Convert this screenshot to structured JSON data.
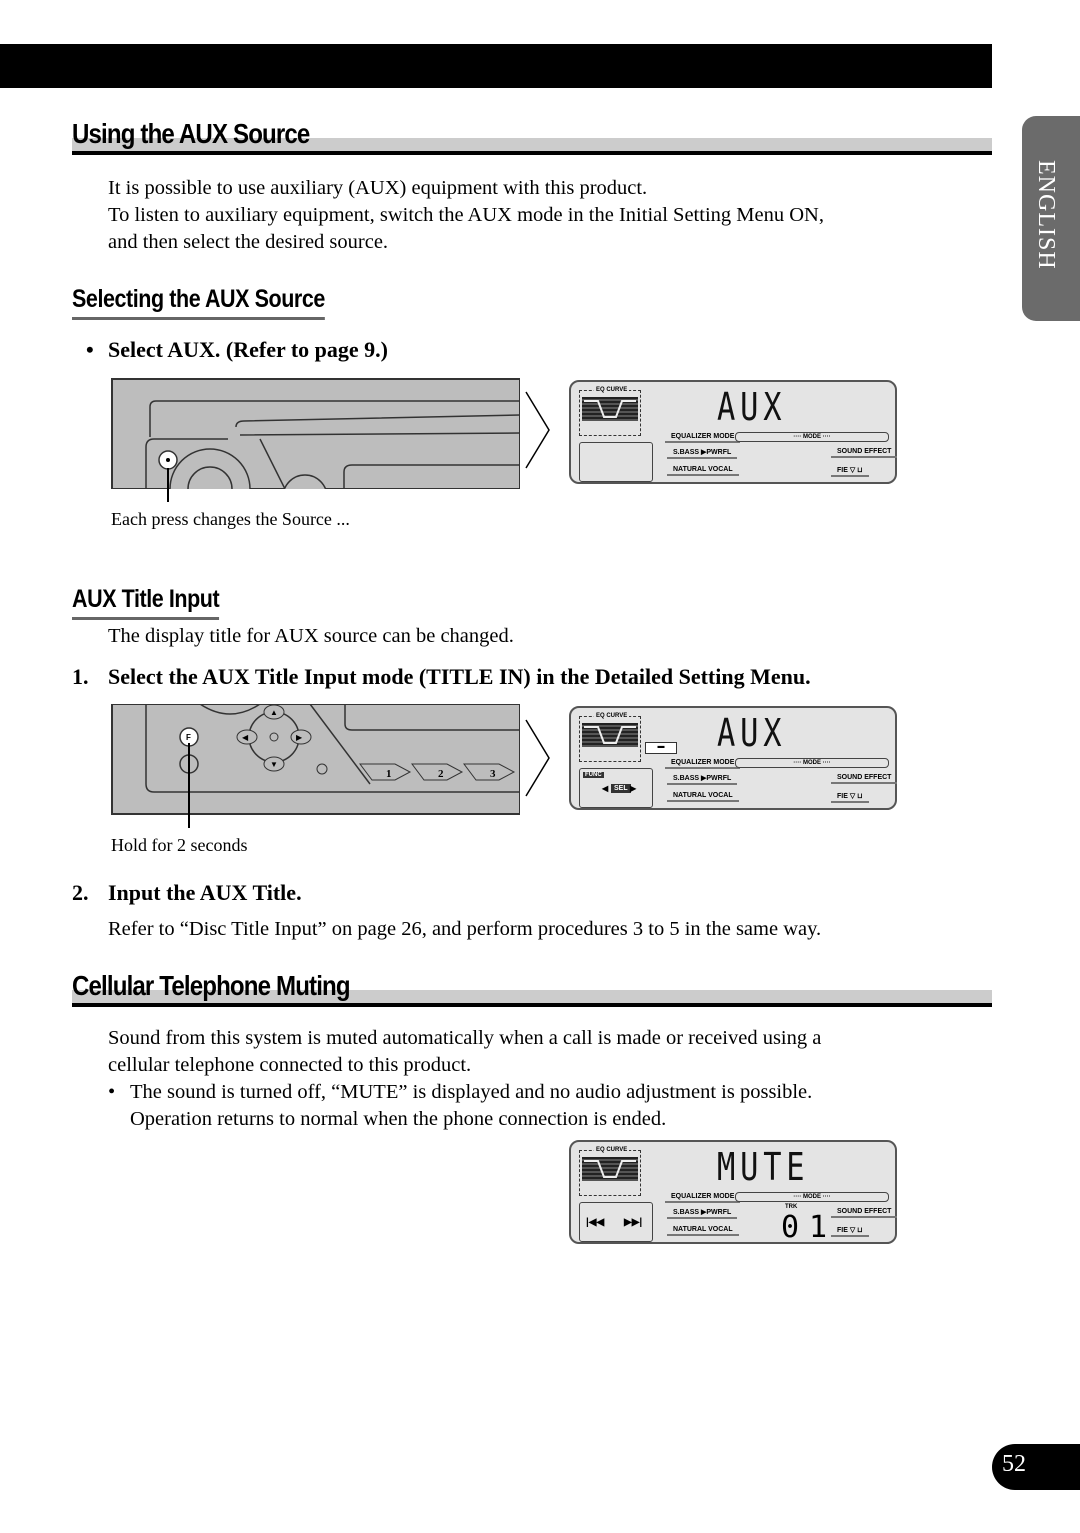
{
  "side_tab": {
    "label": "ENGLISH"
  },
  "page_number": "52",
  "sections": {
    "aux_source": {
      "title": "Using the AUX Source",
      "paragraphs": [
        "It is possible to use auxiliary (AUX) equipment with this product.",
        "To listen to auxiliary equipment, switch the AUX mode in the Initial Setting Menu ON,",
        "and then select the desired source."
      ]
    },
    "selecting": {
      "title": "Selecting the AUX Source",
      "bullet": "Select AUX. (Refer to page 9.)",
      "caption": "Each press changes the Source ...",
      "display_text": "AUX"
    },
    "title_input": {
      "title": "AUX Title Input",
      "intro": "The display title for AUX source can be changed.",
      "step1_num": "1.",
      "step1": "Select the AUX Title Input mode (TITLE IN) in the Detailed Setting Menu.",
      "caption": "Hold for 2 seconds",
      "display_text": "AUX",
      "step2_num": "2.",
      "step2": "Input the AUX Title.",
      "step2_text": "Refer to “Disc Title Input” on page 26, and perform procedures 3 to 5 in the same way.",
      "panel_buttons": [
        "F",
        "1",
        "2",
        "3"
      ]
    },
    "cellular": {
      "title": "Cellular Telephone Muting",
      "paragraphs": [
        "Sound from this system is muted automatically when a call is made or received using a",
        "cellular telephone connected to this product."
      ],
      "bullet_lines": [
        "The sound is turned off, “MUTE” is displayed and no audio adjustment is possible.",
        "Operation returns to normal when the phone connection is ended."
      ],
      "display_text": "MUTE",
      "track_label": "TRK",
      "track_number": "01"
    }
  },
  "lcd_labels": {
    "eq_curve": "EQ CURVE",
    "equalizer_mode": "EQUALIZER MODE",
    "sbass": "S.BASS ▶PWRFL",
    "natural_vocal": "NATURAL  VOCAL",
    "mode": "···· MODE ····",
    "sound_effect": "SOUND EFFECT",
    "fie": "FIE",
    "func": "FUNC",
    "sel": "SEL"
  }
}
